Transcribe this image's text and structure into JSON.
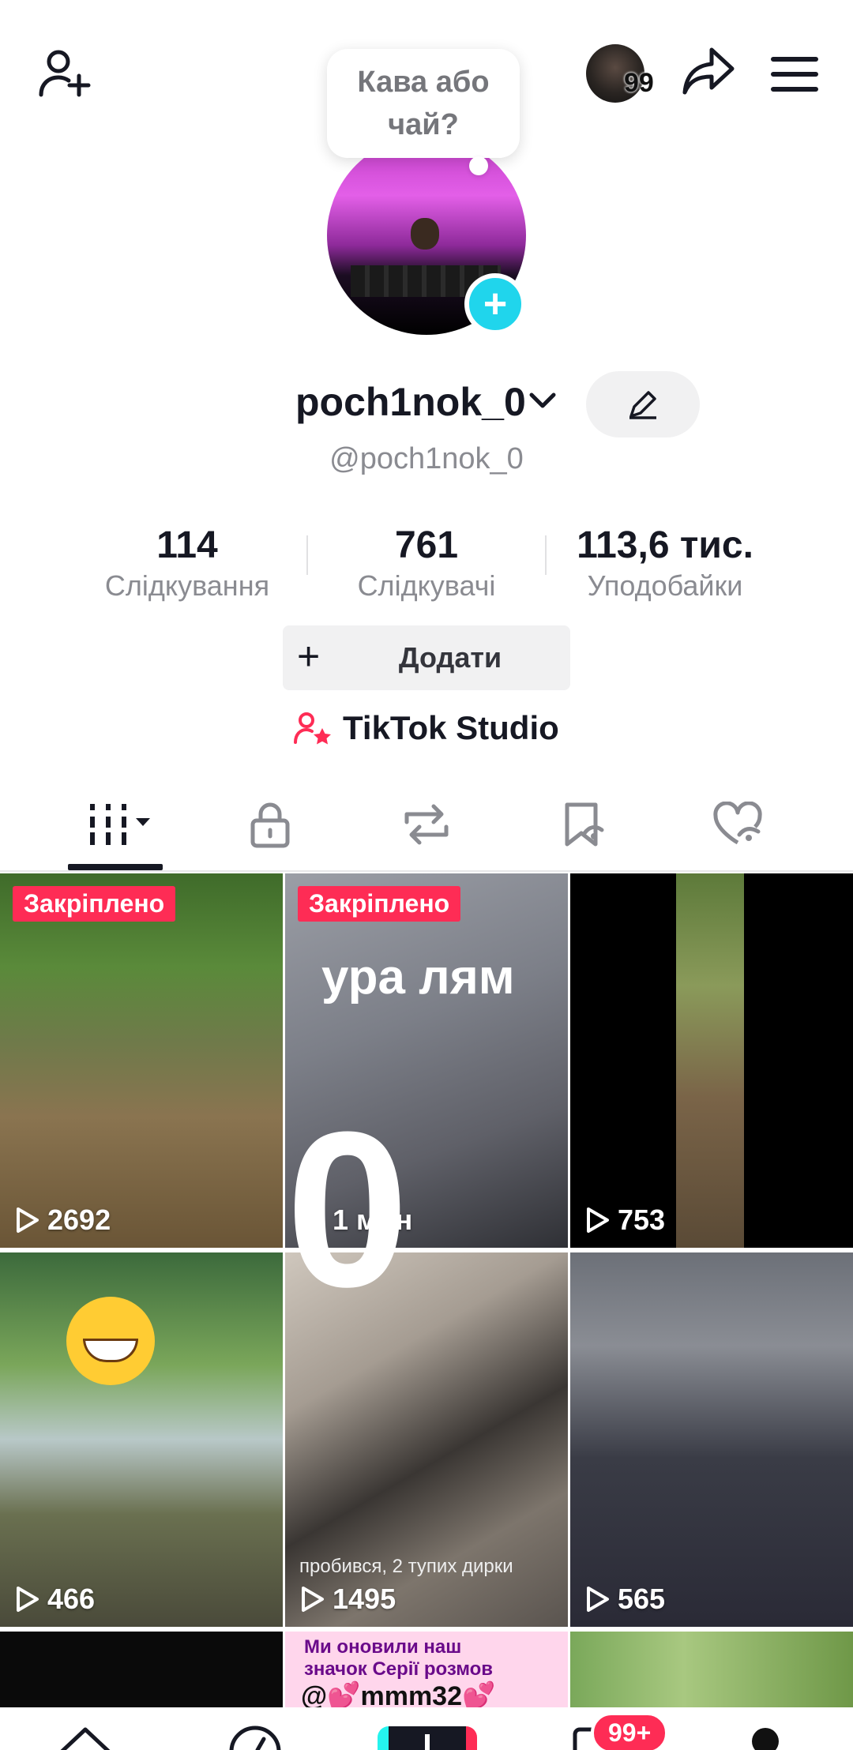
{
  "note": {
    "text": "Кава або чай?"
  },
  "story": {
    "count": "99"
  },
  "profile": {
    "display_name": "poch1nok_0",
    "handle": "@poch1nok_0"
  },
  "stats": [
    {
      "value": "114",
      "label": "Слідкування"
    },
    {
      "value": "761",
      "label": "Слідкувачі"
    },
    {
      "value": "113,6 тис.",
      "label": "Уподобайки"
    }
  ],
  "add_button": {
    "label": "Додати"
  },
  "studio": {
    "label": "TikTok Studio"
  },
  "tabs": [
    {
      "icon": "videos-grid-icon"
    },
    {
      "icon": "lock-icon"
    },
    {
      "icon": "repost-icon"
    },
    {
      "icon": "favorites-icon"
    },
    {
      "icon": "liked-icon"
    }
  ],
  "videos": [
    {
      "pinned_label": "Закріплено",
      "views": "2692"
    },
    {
      "pinned_label": "Закріплено",
      "caption": "ура лям",
      "views": "1 млн",
      "overlay_big": "0"
    },
    {
      "views": "753"
    },
    {
      "views": "466"
    },
    {
      "caption_small": "пробився, 2 тупих дирки",
      "views": "1495"
    },
    {
      "views": "565"
    },
    {
      "views": ""
    },
    {
      "promo_line1": "Ми оновили наш",
      "promo_line2": "значок Серії розмов",
      "promo_line3": "@💕mmm32💕"
    },
    {
      "views": ""
    }
  ],
  "bottom_nav": {
    "inbox_badge": "99+"
  },
  "colors": {
    "accent": "#fe2c55",
    "cyan": "#20d5ec",
    "text": "#161823",
    "muted": "#8a8b91"
  }
}
